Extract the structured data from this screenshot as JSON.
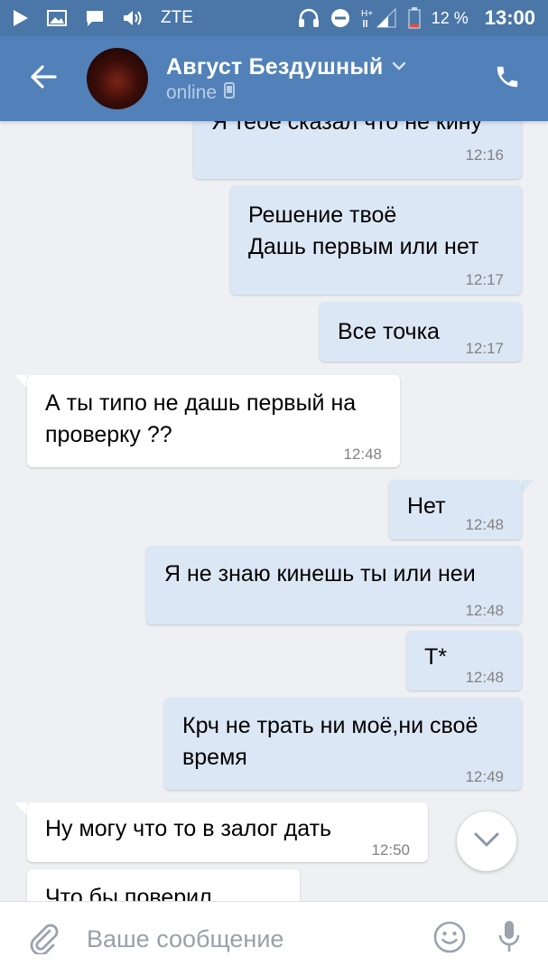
{
  "status_bar": {
    "carrier": "ZTE",
    "network": "H+",
    "battery": "12 %",
    "time": "13:00",
    "icons": [
      "play-icon",
      "gallery-icon",
      "chat-icon",
      "volume-icon",
      "headset-icon",
      "do-not-disturb-icon",
      "signal-icon",
      "battery-icon"
    ]
  },
  "header": {
    "contact_name": "Август Бездушный",
    "status": "online",
    "icons": [
      "back-arrow-icon",
      "chevron-down-icon",
      "mobile-icon",
      "phone-icon"
    ]
  },
  "messages": [
    {
      "direction": "out",
      "text": "Я тебе сказал что не кину",
      "time": "12:16"
    },
    {
      "direction": "out",
      "text": "Решение твоё\nДашь первым или нет",
      "time": "12:17"
    },
    {
      "direction": "out",
      "text": "Все точка",
      "time": "12:17"
    },
    {
      "direction": "in",
      "text": "А ты типо не дашь первый на\nпроверку ??",
      "time": "12:48"
    },
    {
      "direction": "out",
      "text": "Нет",
      "time": "12:48"
    },
    {
      "direction": "out",
      "text": "Я не знаю кинешь ты или неи",
      "time": "12:48"
    },
    {
      "direction": "out",
      "text": "Т*",
      "time": "12:48"
    },
    {
      "direction": "out",
      "text": "Крч не трать ни моё,ни своё\nвремя",
      "time": "12:49"
    },
    {
      "direction": "in",
      "text": "Ну могу что то в залог дать",
      "time": "12:50"
    },
    {
      "direction": "in",
      "text": "Что бы поверил",
      "time": ""
    }
  ],
  "composer": {
    "placeholder": "Ваше сообщение",
    "value": ""
  },
  "colors": {
    "status_bar": "#4a76a8",
    "header": "#5181b8",
    "background": "#eef0f3",
    "outgoing_bubble": "#dce7f5",
    "incoming_bubble": "#ffffff",
    "timestamp": "#828282"
  }
}
